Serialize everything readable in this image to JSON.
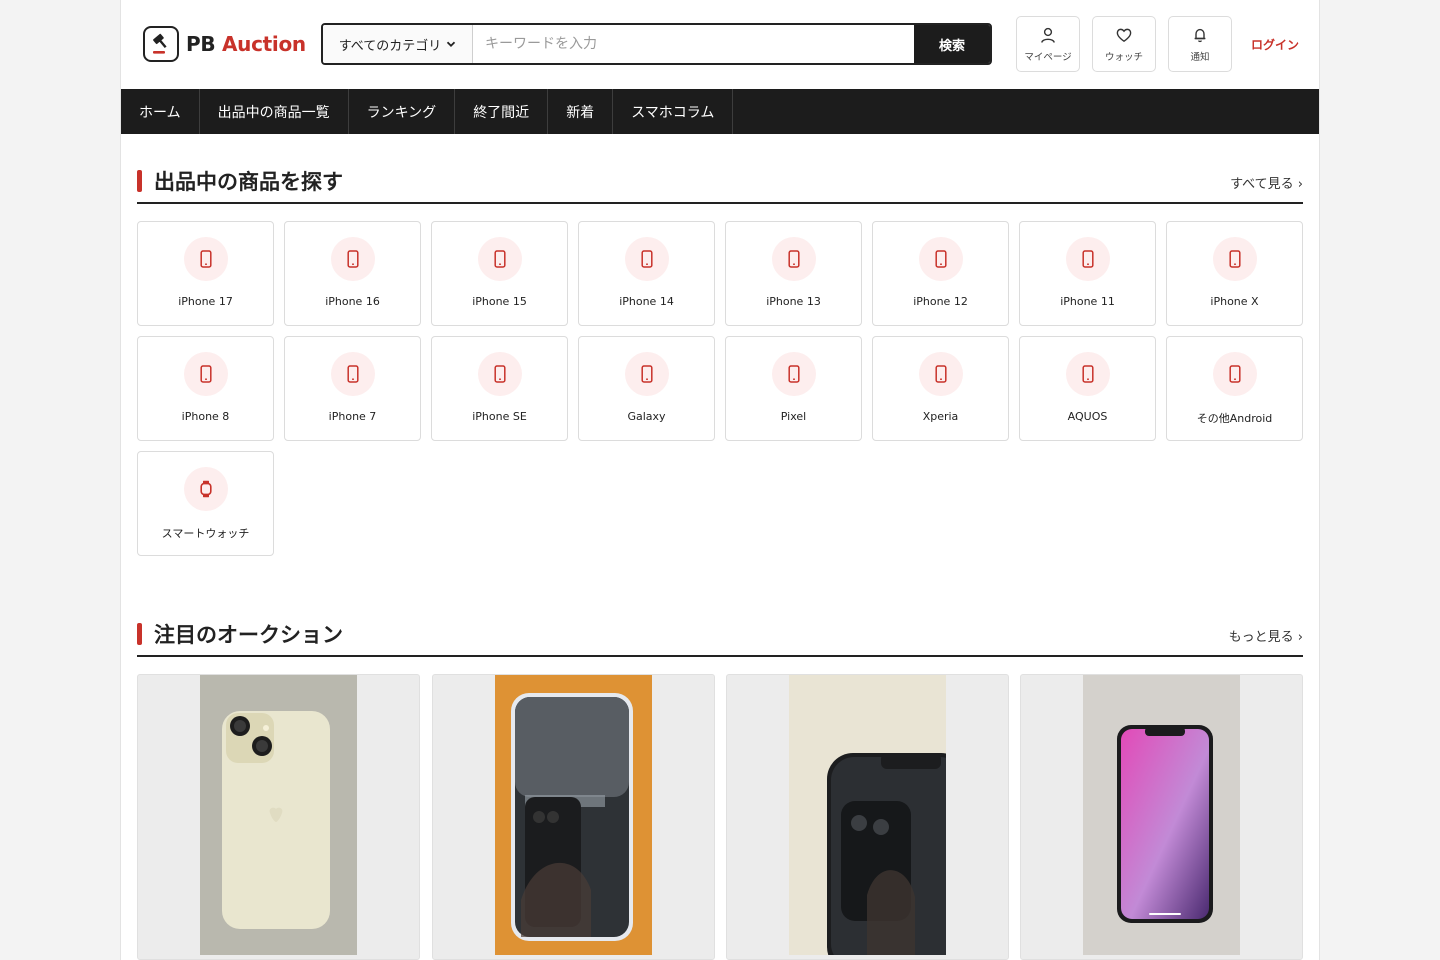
{
  "header": {
    "logo_pb": "PB",
    "logo_auction": "Auction",
    "search": {
      "category": "すべてのカテゴリ",
      "placeholder": "キーワードを入力",
      "button": "検索"
    },
    "buttons": {
      "mypage": "マイページ",
      "watch": "ウォッチ",
      "notify": "通知"
    },
    "login": "ログイン"
  },
  "nav": [
    "ホーム",
    "出品中の商品一覧",
    "ランキング",
    "終了間近",
    "新着",
    "スマホコラム"
  ],
  "browse": {
    "title": "出品中の商品を探す",
    "link": "すべて見る ›",
    "categories": [
      {
        "name": "iPhone 17",
        "icon": "smartphone-icon"
      },
      {
        "name": "iPhone 16",
        "icon": "smartphone-icon"
      },
      {
        "name": "iPhone 15",
        "icon": "smartphone-icon"
      },
      {
        "name": "iPhone 14",
        "icon": "smartphone-icon"
      },
      {
        "name": "iPhone 13",
        "icon": "smartphone-icon"
      },
      {
        "name": "iPhone 12",
        "icon": "smartphone-icon"
      },
      {
        "name": "iPhone 11",
        "icon": "smartphone-icon"
      },
      {
        "name": "iPhone X",
        "icon": "smartphone-icon"
      },
      {
        "name": "iPhone 8",
        "icon": "smartphone-icon"
      },
      {
        "name": "iPhone 7",
        "icon": "smartphone-icon"
      },
      {
        "name": "iPhone SE",
        "icon": "smartphone-icon"
      },
      {
        "name": "Galaxy",
        "icon": "smartphone-icon"
      },
      {
        "name": "Pixel",
        "icon": "smartphone-icon"
      },
      {
        "name": "Xperia",
        "icon": "smartphone-icon"
      },
      {
        "name": "AQUOS",
        "icon": "smartphone-icon"
      },
      {
        "name": "その他Android",
        "icon": "smartphone-icon"
      },
      {
        "name": "スマートウォッチ",
        "icon": "smartwatch-icon"
      }
    ]
  },
  "featured": {
    "title": "注目のオークション",
    "link": "もっと見る ›"
  },
  "colors": {
    "accent": "#c8322a",
    "nav_bg": "#1c1c1c",
    "icon_circle": "#fdeeee"
  }
}
